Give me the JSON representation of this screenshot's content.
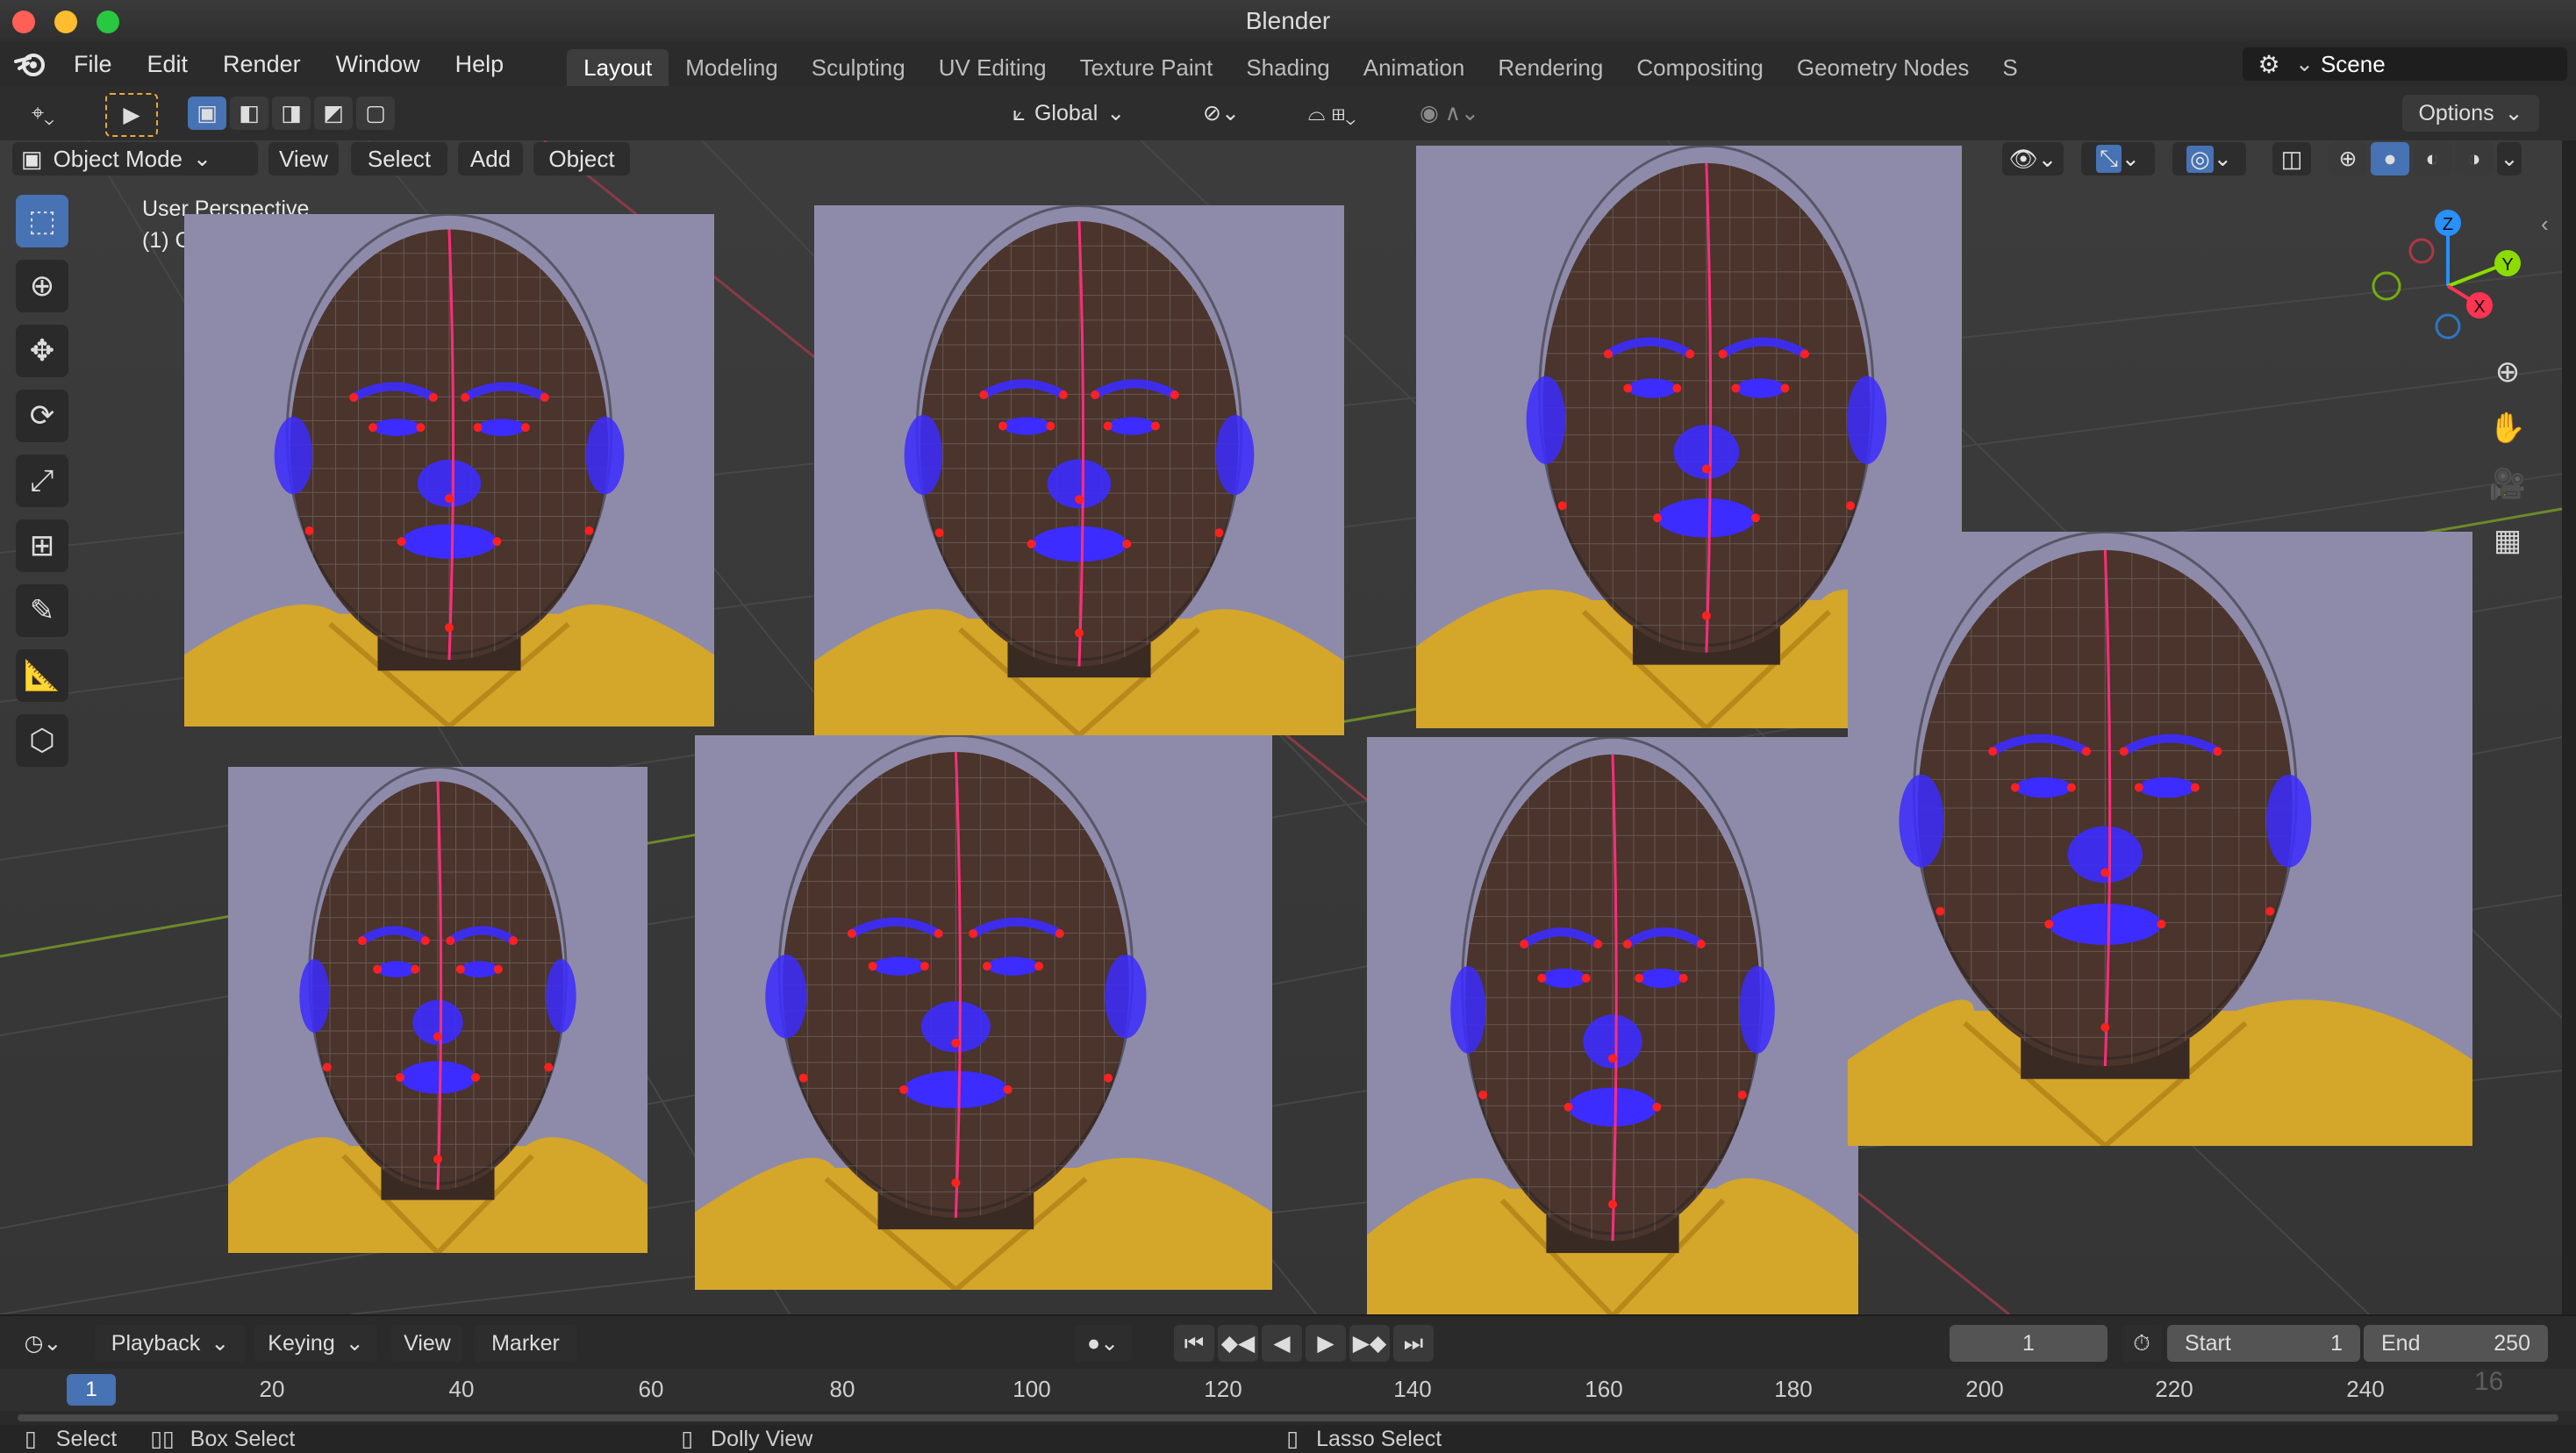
{
  "window": {
    "title": "Blender"
  },
  "menu": {
    "items": [
      "File",
      "Edit",
      "Render",
      "Window",
      "Help"
    ]
  },
  "workspaces": [
    "Layout",
    "Modeling",
    "Sculpting",
    "UV Editing",
    "Texture Paint",
    "Shading",
    "Animation",
    "Rendering",
    "Compositing",
    "Geometry Nodes",
    "S"
  ],
  "active_workspace": "Layout",
  "scene": {
    "name": "Scene"
  },
  "tool_header": {
    "orientation": "Global",
    "options_label": "Options"
  },
  "viewport_header": {
    "mode": "Object Mode",
    "menus": [
      "View",
      "Select",
      "Add",
      "Object"
    ]
  },
  "viewport": {
    "perspective_label": "User Perspective",
    "collection_label": "(1) C"
  },
  "gizmo": {
    "z": "Z",
    "y": "Y",
    "x": "X"
  },
  "timeline": {
    "menus": [
      "Playback",
      "Keying",
      "View",
      "Marker"
    ],
    "current_frame": "1",
    "start_label": "Start",
    "start_value": "1",
    "end_label": "End",
    "end_value": "250",
    "ticks": [
      "1",
      "20",
      "40",
      "60",
      "80",
      "100",
      "120",
      "140",
      "160",
      "180",
      "200",
      "220",
      "240"
    ],
    "corner_number": "16"
  },
  "statusbar": {
    "select": "Select",
    "box_select": "Box Select",
    "dolly_view": "Dolly View",
    "lasso_select": "Lasso Select"
  },
  "colors": {
    "accent": "#4772b3",
    "mesh_overlay": "#3c2cff",
    "midline": "#ff2d7a",
    "landmarks": "#ff2020",
    "axis_x": "#ff3352",
    "axis_y": "#8bdc00",
    "axis_z": "#2890ff"
  }
}
